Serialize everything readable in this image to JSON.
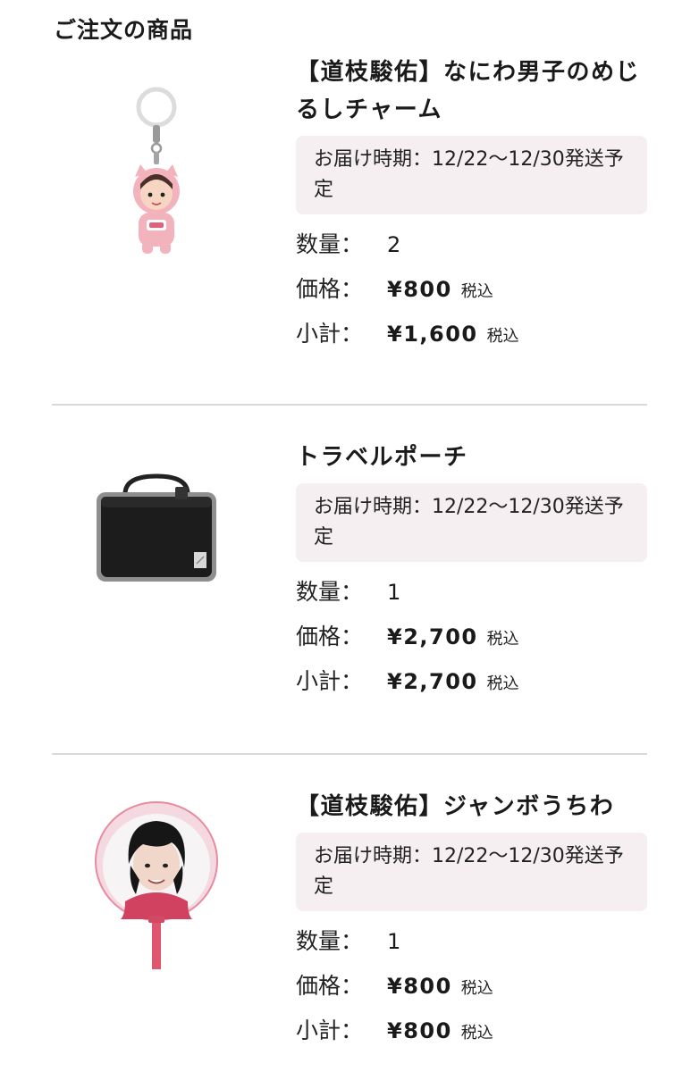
{
  "section_title": "ご注文の商品",
  "items": [
    {
      "name": "【道枝駿佑】なにわ男子のめじるしチャーム",
      "shipping": "お届け時期：12/22〜12/30発送予定",
      "qty_label": "数量：",
      "qty": "2",
      "price_label": "価格：",
      "price": "¥800",
      "price_tax": "税込",
      "subtotal_label": "小計：",
      "subtotal": "¥1,600",
      "subtotal_tax": "税込",
      "image_icon": "keychain-charm-image"
    },
    {
      "name": "トラベルポーチ",
      "shipping": "お届け時期：12/22〜12/30発送予定",
      "qty_label": "数量：",
      "qty": "1",
      "price_label": "価格：",
      "price": "¥2,700",
      "price_tax": "税込",
      "subtotal_label": "小計：",
      "subtotal": "¥2,700",
      "subtotal_tax": "税込",
      "image_icon": "travel-pouch-image"
    },
    {
      "name": "【道枝駿佑】ジャンボうちわ",
      "shipping": "お届け時期：12/22〜12/30発送予定",
      "qty_label": "数量：",
      "qty": "1",
      "price_label": "価格：",
      "price": "¥800",
      "price_tax": "税込",
      "subtotal_label": "小計：",
      "subtotal": "¥800",
      "subtotal_tax": "税込",
      "image_icon": "jumbo-fan-image"
    }
  ],
  "colors": {
    "shipping_bg": "#f6eff1",
    "divider": "#d9d9d9",
    "text": "#1a1a1a",
    "charm_pink": "#f3b3bd",
    "fan_pink": "#e0566f"
  }
}
